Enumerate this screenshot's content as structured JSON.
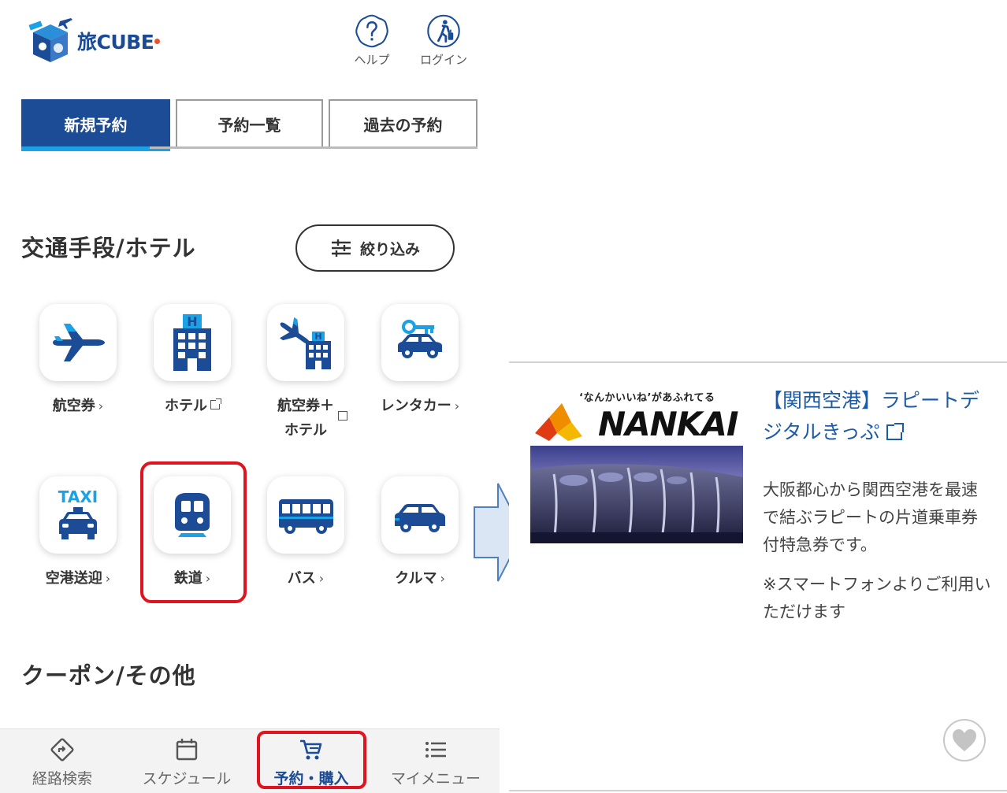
{
  "header": {
    "logo_text": "旅CUBE",
    "help_label": "ヘルプ",
    "login_label": "ログイン"
  },
  "tabs": {
    "new": "新規予約",
    "list": "予約一覧",
    "past": "過去の予約"
  },
  "transport_section": {
    "title": "交通手段/ホテル",
    "filter_label": "絞り込み",
    "items": [
      {
        "label": "航空券",
        "suffix": "chevron"
      },
      {
        "label": "ホテル",
        "suffix": "external"
      },
      {
        "label": "航空券＋ホテル",
        "suffix": "external"
      },
      {
        "label": "レンタカー",
        "suffix": "chevron"
      },
      {
        "label": "空港送迎",
        "suffix": "chevron"
      },
      {
        "label": "鉄道",
        "suffix": "chevron"
      },
      {
        "label": "バス",
        "suffix": "chevron"
      },
      {
        "label": "クルマ",
        "suffix": "chevron"
      }
    ],
    "airticket_hotel_line1": "航空券＋",
    "airticket_hotel_line2": "ホテル",
    "taxi_sign": "TAXI"
  },
  "coupon_section": {
    "title": "クーポン/その他"
  },
  "bottom_nav": {
    "route": "経路検索",
    "schedule": "スケジュール",
    "booking": "予約・購入",
    "menu": "マイメニュー"
  },
  "product": {
    "banner_catch": "‘なんかいいね’があふれてる",
    "banner_brand": "NANKAI",
    "title": "【関西空港】ラピートデジタルきっぷ",
    "description": "大阪都心から関西空港を最速で結ぶラピートの片道乗車券付特急券です。",
    "note": "※スマートフォンよりご利用いただけます"
  },
  "colors": {
    "brand_navy": "#1c4c96",
    "accent_cyan": "#1aa1e6",
    "highlight_red": "#e0141e",
    "link_blue": "#1c5ba8",
    "nankai_orange": "#f08c00",
    "nankai_red": "#e03c14"
  }
}
